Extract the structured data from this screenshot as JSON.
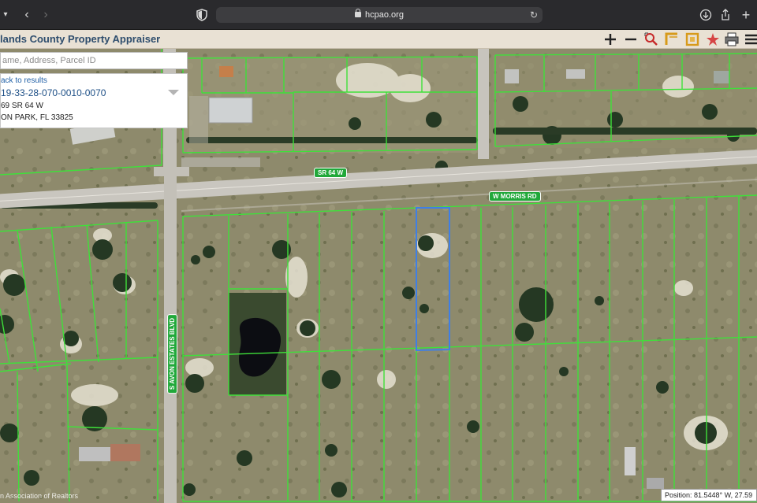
{
  "browser": {
    "url": "hcpao.org",
    "buttons": [
      "sidebar-chevron",
      "back",
      "forward",
      "shield",
      "reload",
      "downloads",
      "share",
      "new-tab"
    ]
  },
  "app": {
    "title": "lands County Property Appraiser",
    "tools": [
      "zoom-in-icon",
      "zoom-out-icon",
      "zoom-box-icon",
      "measure-icon",
      "select-box-icon",
      "pin-icon",
      "print-icon",
      "menu-icon"
    ],
    "accent": "#d79a1a"
  },
  "search": {
    "placeholder": "ame, Address, Parcel ID",
    "value": ""
  },
  "result": {
    "back_label": "ack to results",
    "parcel_id": "19-33-28-070-0010-0070",
    "address_line1": "69 SR 64 W",
    "address_line2": "ON PARK, FL 33825"
  },
  "map": {
    "road_labels": {
      "sr64": "SR 64 W",
      "morris": "W MORRIS RD",
      "avon": "S AVON ESTATES BLVD"
    },
    "colors": {
      "parcel_line": "#3fe03a",
      "selected_parcel": "#3f7fe6",
      "road": "#cfccc4",
      "terrain": "#8b8668"
    },
    "copyright": "n Association of Realtors",
    "position_readout": "Position: 81.5448° W, 27.59"
  }
}
